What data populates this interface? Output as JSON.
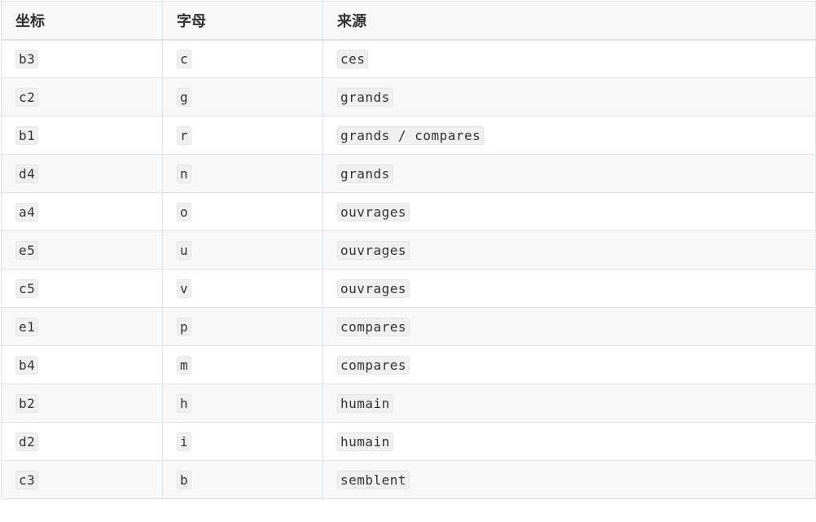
{
  "table": {
    "headers": [
      "坐标",
      "字母",
      "来源"
    ],
    "rows": [
      {
        "coord": "b3",
        "letter": "c",
        "source": "ces"
      },
      {
        "coord": "c2",
        "letter": "g",
        "source": "grands"
      },
      {
        "coord": "b1",
        "letter": "r",
        "source": "grands / compares"
      },
      {
        "coord": "d4",
        "letter": "n",
        "source": "grands"
      },
      {
        "coord": "a4",
        "letter": "o",
        "source": "ouvrages"
      },
      {
        "coord": "e5",
        "letter": "u",
        "source": "ouvrages"
      },
      {
        "coord": "c5",
        "letter": "v",
        "source": "ouvrages"
      },
      {
        "coord": "e1",
        "letter": "p",
        "source": "compares"
      },
      {
        "coord": "b4",
        "letter": "m",
        "source": "compares"
      },
      {
        "coord": "b2",
        "letter": "h",
        "source": "humain"
      },
      {
        "coord": "d2",
        "letter": "i",
        "source": "humain"
      },
      {
        "coord": "c3",
        "letter": "b",
        "source": "semblent"
      }
    ]
  }
}
